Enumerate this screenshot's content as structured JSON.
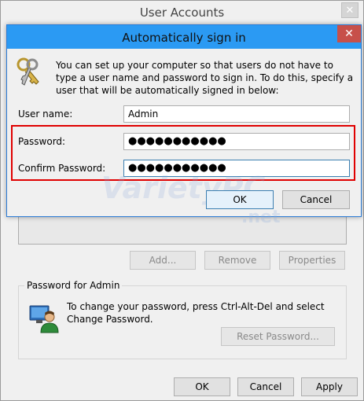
{
  "outer_window": {
    "title": "User Accounts",
    "close_glyph": "✕",
    "buttons": {
      "add": "Add...",
      "remove": "Remove",
      "properties": "Properties"
    },
    "password_group": {
      "label": "Password for Admin",
      "description": "To change your password, press Ctrl-Alt-Del and select Change Password.",
      "reset_button": "Reset Password..."
    },
    "footer": {
      "ok": "OK",
      "cancel": "Cancel",
      "apply": "Apply"
    }
  },
  "dialog": {
    "title": "Automatically sign in",
    "close_glyph": "✕",
    "description": "You can set up your computer so that users do not have to type a user name and password to sign in. To do this, specify a user that will be automatically signed in below:",
    "fields": {
      "username_label": "User name:",
      "username_value": "Admin",
      "password_label": "Password:",
      "password_value": "●●●●●●●●●●●",
      "confirm_label": "Confirm Password:",
      "confirm_value": "●●●●●●●●●●●"
    },
    "buttons": {
      "ok": "OK",
      "cancel": "Cancel"
    }
  },
  "watermark": {
    "main": "VarietyPC",
    "sub": ".net"
  },
  "colors": {
    "dialog_titlebar": "#2b9af3",
    "close_red": "#c7504a",
    "highlight_red": "#e00000"
  },
  "icons": [
    "keys-icon",
    "user-icon",
    "close-icon"
  ]
}
